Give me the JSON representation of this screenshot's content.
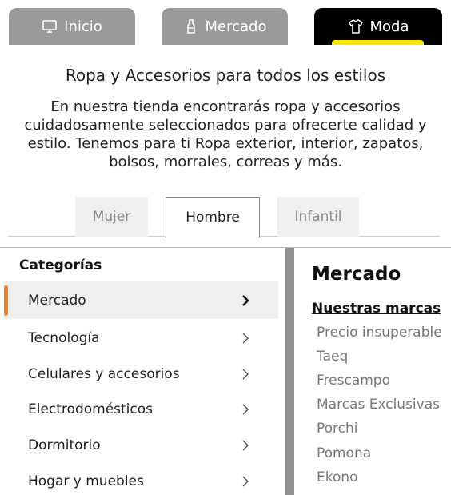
{
  "top_tabs": [
    {
      "label": "Inicio",
      "icon": "monitor-icon"
    },
    {
      "label": "Mercado",
      "icon": "bottle-icon"
    },
    {
      "label": "Moda",
      "icon": "shirt-icon"
    }
  ],
  "moda": {
    "title": "Ropa y Accesorios para todos los estilos",
    "description": "En nuestra tienda encontrarás ropa y accesorios cuidadosamente seleccionados para ofrecerte calidad y estilo. Tenemos para ti Ropa exterior, interior, zapatos, bolsos, morrales, correas y más.",
    "sub_tabs": [
      "Mujer",
      "Hombre",
      "Infantil"
    ],
    "active_sub_tab": "Hombre"
  },
  "categories": {
    "heading": "Categorías",
    "items": [
      "Mercado",
      "Tecnología",
      "Celulares y accesorios",
      "Electrodomésticos",
      "Dormitorio",
      "Hogar y muebles"
    ],
    "active": "Mercado"
  },
  "brands": {
    "title": "Mercado",
    "subtitle": "Nuestras marcas",
    "items": [
      "Precio insuperable",
      "Taeq",
      "Frescampo",
      "Marcas Exclusivas",
      "Porchi",
      "Pomona",
      "Ekono"
    ]
  },
  "colors": {
    "accent": "#f08020",
    "active_tab": "#000000",
    "inactive_tab": "#9a9a9a",
    "highlight": "#ffe500"
  }
}
